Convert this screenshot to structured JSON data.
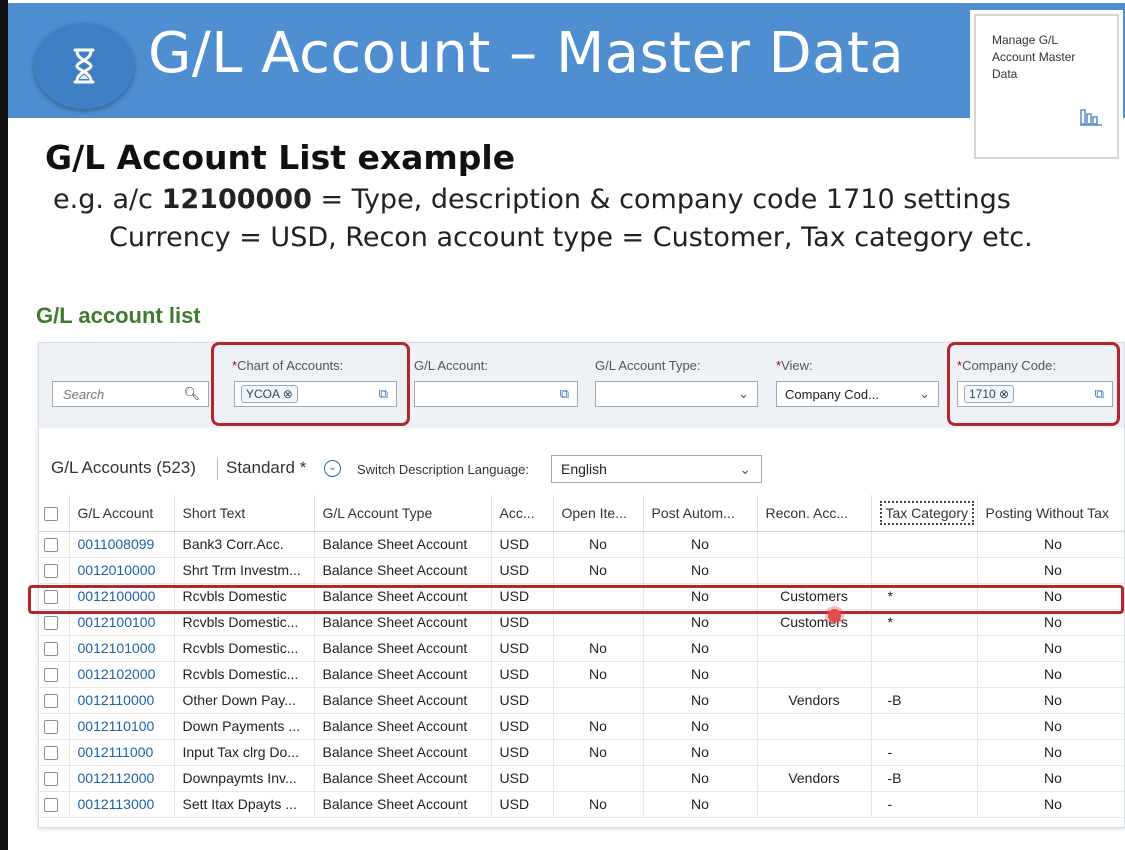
{
  "banner": {
    "title": "G/L Account – Master Data"
  },
  "tile": {
    "text": "Manage G/L Account Master Data"
  },
  "heading": "G/L Account List example",
  "line1": {
    "prefix": "e.g. a/c ",
    "account": "12100000",
    "suffix": " = Type, description & company code 1710 settings"
  },
  "line2": "Currency = USD, Recon account type = Customer, Tax category etc.",
  "section_title": "G/L account list",
  "filters": {
    "search_placeholder": "Search",
    "chart_label": "Chart of Accounts:",
    "chart_value": "YCOA",
    "gl_account_label": "G/L Account:",
    "gl_type_label": "G/L Account Type:",
    "view_label": "View:",
    "view_value": "Company Cod...",
    "company_label": "Company Code:",
    "company_value": "1710",
    "required_mark": "*"
  },
  "toolbar": {
    "title": "G/L Accounts (523)",
    "variant": "Standard *",
    "switch_lang_label": "Switch Description Language:",
    "language": "English"
  },
  "columns": [
    "G/L Account",
    "Short Text",
    "G/L Account Type",
    "Acc...",
    "Open Ite...",
    "Post Autom...",
    "Recon. Acc...",
    "Tax Category",
    "Posting Without Tax"
  ],
  "rows": [
    {
      "acct": "0011008099",
      "text": "Bank3 Corr.Acc.",
      "type": "Balance Sheet Account",
      "cur": "USD",
      "open": "No",
      "post": "No",
      "recon": "",
      "tax": "",
      "pwt": "No"
    },
    {
      "acct": "0012010000",
      "text": "Shrt Trm Investm...",
      "type": "Balance Sheet Account",
      "cur": "USD",
      "open": "No",
      "post": "No",
      "recon": "",
      "tax": "",
      "pwt": "No"
    },
    {
      "acct": "0012100000",
      "text": "Rcvbls Domestic",
      "type": "Balance Sheet Account",
      "cur": "USD",
      "open": "",
      "post": "No",
      "recon": "Customers",
      "tax": "*",
      "pwt": "No"
    },
    {
      "acct": "0012100100",
      "text": "Rcvbls Domestic...",
      "type": "Balance Sheet Account",
      "cur": "USD",
      "open": "",
      "post": "No",
      "recon": "Customers",
      "tax": "*",
      "pwt": "No"
    },
    {
      "acct": "0012101000",
      "text": "Rcvbls Domestic...",
      "type": "Balance Sheet Account",
      "cur": "USD",
      "open": "No",
      "post": "No",
      "recon": "",
      "tax": "",
      "pwt": "No"
    },
    {
      "acct": "0012102000",
      "text": "Rcvbls Domestic...",
      "type": "Balance Sheet Account",
      "cur": "USD",
      "open": "No",
      "post": "No",
      "recon": "",
      "tax": "",
      "pwt": "No"
    },
    {
      "acct": "0012110000",
      "text": "Other Down Pay...",
      "type": "Balance Sheet Account",
      "cur": "USD",
      "open": "",
      "post": "No",
      "recon": "Vendors",
      "tax": "-B",
      "pwt": "No"
    },
    {
      "acct": "0012110100",
      "text": "Down Payments ...",
      "type": "Balance Sheet Account",
      "cur": "USD",
      "open": "No",
      "post": "No",
      "recon": "",
      "tax": "",
      "pwt": "No"
    },
    {
      "acct": "0012111000",
      "text": "Input Tax clrg Do...",
      "type": "Balance Sheet Account",
      "cur": "USD",
      "open": "No",
      "post": "No",
      "recon": "",
      "tax": "-",
      "pwt": "No"
    },
    {
      "acct": "0012112000",
      "text": "Downpaymts Inv...",
      "type": "Balance Sheet Account",
      "cur": "USD",
      "open": "",
      "post": "No",
      "recon": "Vendors",
      "tax": "-B",
      "pwt": "No"
    },
    {
      "acct": "0012113000",
      "text": "Sett Itax Dpayts ...",
      "type": "Balance Sheet Account",
      "cur": "USD",
      "open": "No",
      "post": "No",
      "recon": "",
      "tax": "-",
      "pwt": "No"
    }
  ]
}
